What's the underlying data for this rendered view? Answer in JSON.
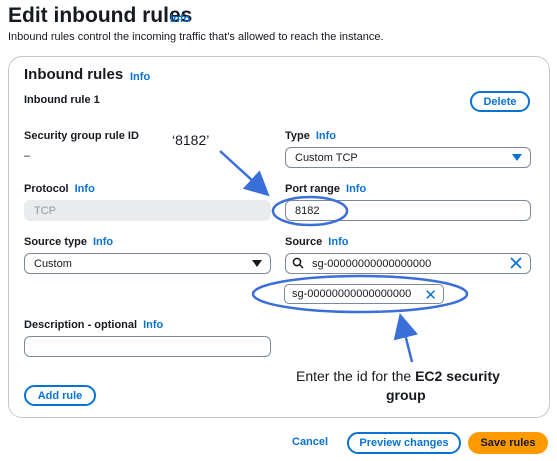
{
  "page": {
    "title": "Edit inbound rules",
    "info": "Info",
    "description": "Inbound rules control the incoming traffic that's allowed to reach the instance."
  },
  "card": {
    "title": "Inbound rules",
    "info": "Info",
    "rule_label": "Inbound rule 1",
    "delete_label": "Delete",
    "add_rule_label": "Add rule"
  },
  "fields": {
    "rule_id_label": "Security group rule ID",
    "rule_id_value": "–",
    "type_label": "Type",
    "type_info": "Info",
    "type_value": "Custom TCP",
    "protocol_label": "Protocol",
    "protocol_info": "Info",
    "protocol_value": "TCP",
    "port_label": "Port range",
    "port_info": "Info",
    "port_value": "8182",
    "source_type_label": "Source type",
    "source_type_info": "Info",
    "source_type_value": "Custom",
    "source_label": "Source",
    "source_info": "Info",
    "source_value": "sg-00000000000000000",
    "token_value": "sg-00000000000000000",
    "description_label": "Description - optional",
    "description_info": "Info",
    "description_value": ""
  },
  "annotations": {
    "port_callout": "‘8182’",
    "instruction_line1_prefix": "Enter the id for the ",
    "instruction_line1_bold": "EC2 security",
    "instruction_line2_bold": "group"
  },
  "footer": {
    "cancel_label": "Cancel",
    "preview_label": "Preview changes",
    "save_label": "Save rules"
  },
  "colors": {
    "accent": "#0972d3",
    "primary_button": "#ff9900",
    "annotation": "#3b6fd8"
  }
}
